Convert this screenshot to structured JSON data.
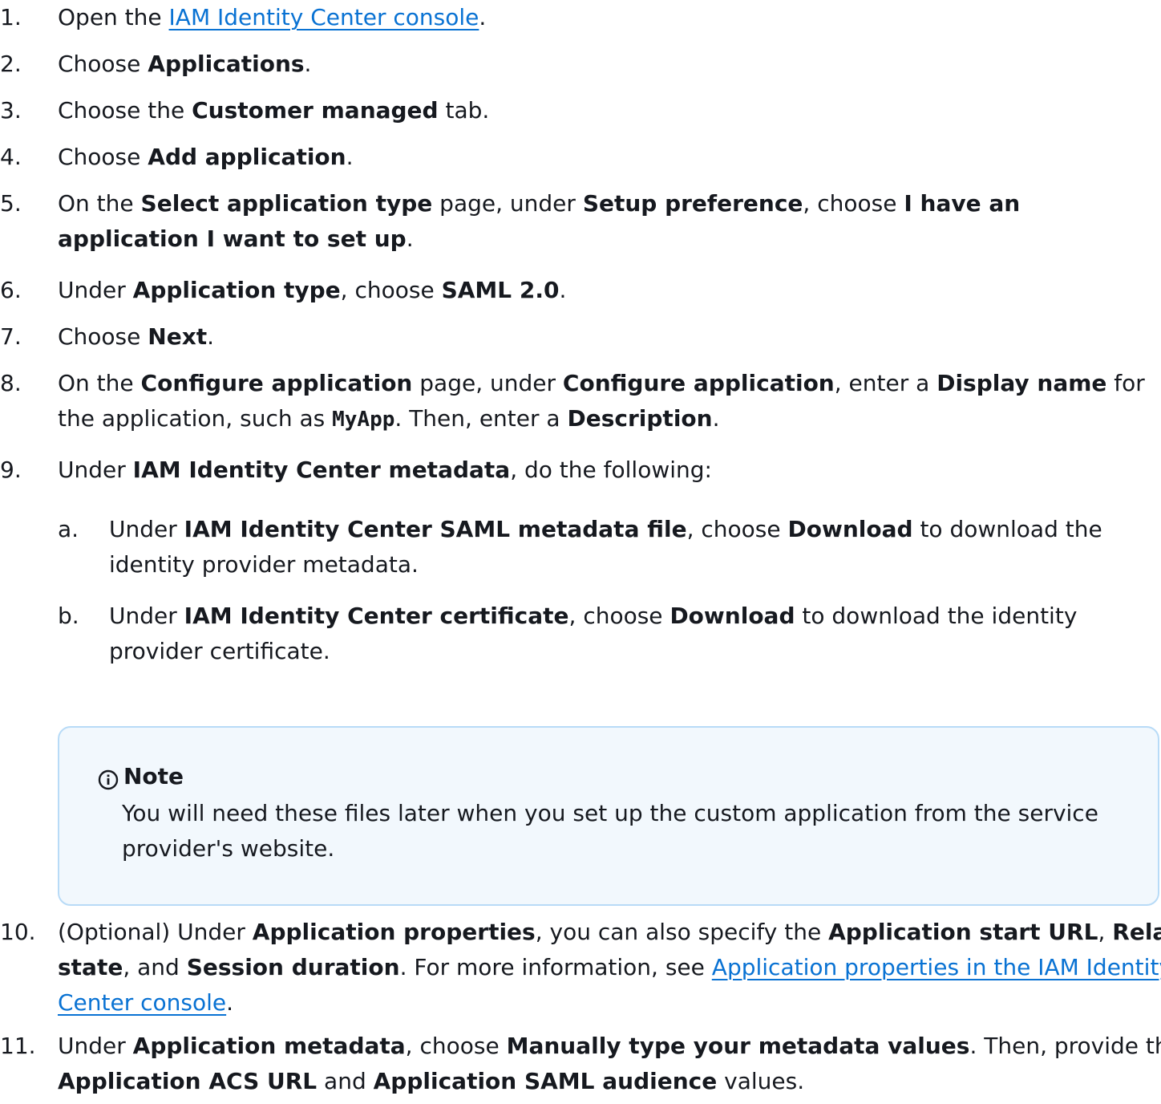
{
  "steps": [
    {
      "num": "1.",
      "t1": "Open the ",
      "link": "IAM Identity Center console",
      "t2": "."
    },
    {
      "num": "2.",
      "t1": "Choose ",
      "b1": "Applications",
      "t2": "."
    },
    {
      "num": "3.",
      "t1": "Choose the ",
      "b1": "Customer managed",
      "t2": " tab."
    },
    {
      "num": "4.",
      "t1": "Choose ",
      "b1": "Add application",
      "t2": "."
    },
    {
      "num": "5.",
      "t1": "On the ",
      "b1": "Select application type",
      "t2": " page, under ",
      "b2": "Setup preference",
      "t3": ", choose ",
      "b3": "I have an application I want to set up",
      "t4": "."
    },
    {
      "num": "6.",
      "t1": "Under ",
      "b1": "Application type",
      "t2": ", choose ",
      "b2": "SAML 2.0",
      "t3": "."
    },
    {
      "num": "7.",
      "t1": "Choose ",
      "b1": "Next",
      "t2": "."
    },
    {
      "num": "8.",
      "t1": "On the ",
      "b1": "Configure application",
      "t2": " page, under ",
      "b2": "Configure application",
      "t3": ", enter a ",
      "b3": "Display name",
      "t4": " for the application, such as ",
      "code": "MyApp",
      "t5": ". Then, enter a ",
      "b4": "Description",
      "t6": "."
    },
    {
      "num": "9.",
      "t1": "Under ",
      "b1": "IAM Identity Center metadata",
      "t2": ", do the following:"
    },
    {
      "num": "10.",
      "t1": "(Optional) Under ",
      "b1": "Application properties",
      "t2": ", you can also specify the ",
      "b2": "Application start URL",
      "t3": ", ",
      "b3": "Relay state",
      "t4": ", and ",
      "b4": "Session duration",
      "t5": ". For more information, see ",
      "link": "Application properties in the IAM Identity Center console",
      "t6": "."
    },
    {
      "num": "11.",
      "t1": "Under ",
      "b1": "Application metadata",
      "t2": ", choose ",
      "b2": "Manually type your metadata values",
      "t3": ". Then, provide the ",
      "b3": "Application ACS URL",
      "t4": " and ",
      "b4": "Application SAML audience",
      "t5": " values."
    }
  ],
  "substeps": [
    {
      "letter": "a.",
      "t1": "Under ",
      "b1": "IAM Identity Center SAML metadata file",
      "t2": ", choose ",
      "b2": "Download",
      "t3": " to download the identity provider metadata."
    },
    {
      "letter": "b.",
      "t1": "Under ",
      "b1": "IAM Identity Center certificate",
      "t2": ", choose ",
      "b2": "Download",
      "t3": " to download the identity provider certificate."
    }
  ],
  "note": {
    "title": "Note",
    "body": "You will need these files later when you set up the custom application from the service provider's website.",
    "icon": "info-icon",
    "border_color": "#b8dbf7",
    "background_color": "#f2f8fd"
  },
  "link_color": "#0972d3"
}
